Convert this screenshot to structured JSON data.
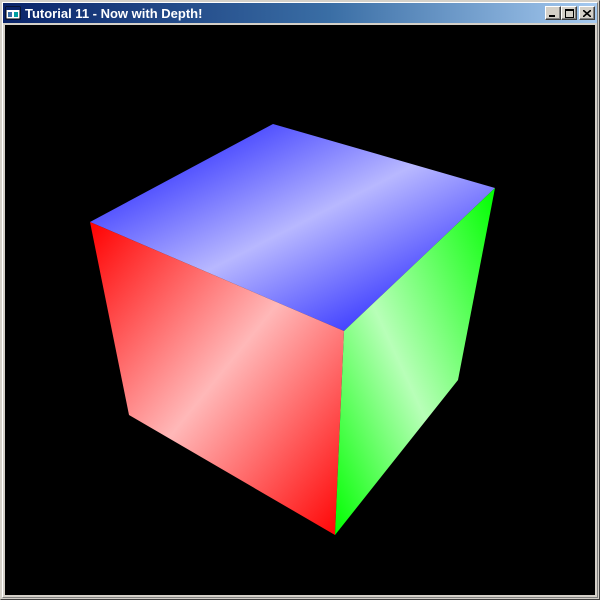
{
  "window": {
    "title": "Tutorial 11 - Now with Depth!",
    "icon": "opengl-app-icon",
    "buttons": {
      "minimize": "minimize-icon",
      "maximize": "maximize-icon",
      "close": "close-icon"
    }
  },
  "scene": {
    "background": "#000000",
    "faces": {
      "top": {
        "color": "#0000ff",
        "highlight": "#b8b8ff"
      },
      "left": {
        "color": "#ff0000",
        "highlight": "#ffb8b8"
      },
      "right": {
        "color": "#00ff00",
        "highlight": "#b8ffb8"
      }
    }
  }
}
